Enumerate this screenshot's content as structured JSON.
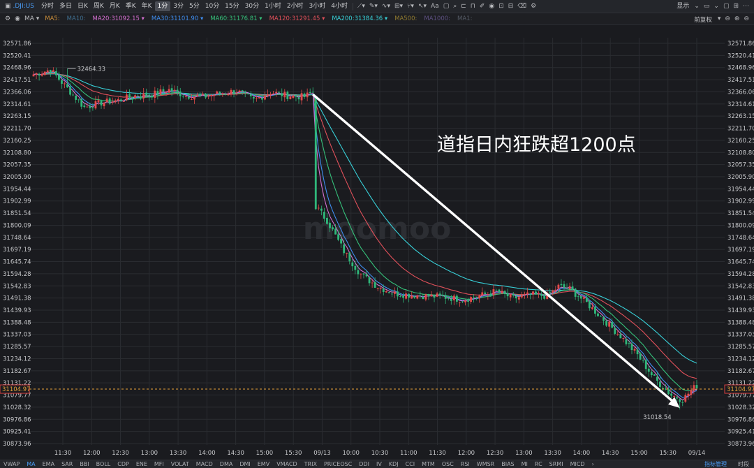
{
  "toolbar": {
    "symbol": ".DJI:US",
    "periods": [
      "分时",
      "多日",
      "日K",
      "周K",
      "月K",
      "季K",
      "年K",
      "1分",
      "3分",
      "5分",
      "10分",
      "15分",
      "30分",
      "1小时",
      "2小时",
      "3小时",
      "4小时"
    ],
    "active_period": "1分",
    "display_label": "显示"
  },
  "ma_bar": {
    "items": [
      {
        "label": "MA5:",
        "color": "#c58b3a"
      },
      {
        "label": "MA10:",
        "color": "#3f6e8f"
      },
      {
        "label": "MA20:31092.15",
        "color": "#d36fd0"
      },
      {
        "label": "MA30:31101.90",
        "color": "#3f8ef0"
      },
      {
        "label": "MA60:31176.81",
        "color": "#35c07a"
      },
      {
        "label": "MA120:31291.45",
        "color": "#e0505a"
      },
      {
        "label": "MA200:31384.36",
        "color": "#38d0d8"
      },
      {
        "label": "MA500:",
        "color": "#8f7a30"
      },
      {
        "label": "MA1000:",
        "color": "#5c4f80"
      },
      {
        "label": "MA1:",
        "color": "#555b66"
      }
    ],
    "adjust_label": "前复权"
  },
  "bottom_bar": {
    "indicators": [
      "VWAP",
      "MA",
      "EMA",
      "SAR",
      "BBI",
      "BOLL",
      "CDP",
      "ENE",
      "MFI",
      "VOLAT",
      "MACD",
      "DMA",
      "DMI",
      "EMV",
      "VMACD",
      "TRIX",
      "PRICEOSC",
      "DDI",
      "IV",
      "KDJ",
      "CCI",
      "MTM",
      "OSC",
      "RSI",
      "WMSR",
      "BIAS",
      "MI",
      "RC",
      "SRMI",
      "MICD"
    ],
    "active": "MA",
    "manage_label": "指标管理",
    "time_label": "时段"
  },
  "annotation": {
    "text": "道指日内狂跌超1200点"
  },
  "watermark": "moomoo",
  "colors": {
    "up": "#e24a4a",
    "down": "#2fb77a",
    "background": "#1a1b1f",
    "grid": "#2a2c31",
    "current_price": "#e8a23a"
  },
  "chart_data": {
    "type": "candlestick",
    "symbol": ".DJI:US",
    "y_ticks": [
      "32571.86",
      "32520.41",
      "32468.96",
      "32417.51",
      "32366.06",
      "32314.61",
      "32263.15",
      "32211.70",
      "32160.25",
      "32108.80",
      "32057.35",
      "32005.90",
      "31954.44",
      "31902.99",
      "31851.54",
      "31800.09",
      "31748.64",
      "31697.19",
      "31645.74",
      "31594.28",
      "31542.83",
      "31491.38",
      "31439.93",
      "31388.48",
      "31337.03",
      "31285.57",
      "31234.12",
      "31182.67",
      "31131.22",
      "31079.77",
      "31028.32",
      "30976.86",
      "30925.41",
      "30873.96"
    ],
    "ylim": [
      30873.96,
      32571.86
    ],
    "x_ticks": [
      "11:30",
      "12:00",
      "12:30",
      "13:00",
      "13:30",
      "14:00",
      "14:30",
      "15:00",
      "15:30",
      "09/13",
      "10:00",
      "10:30",
      "11:00",
      "11:30",
      "12:00",
      "12:30",
      "13:00",
      "13:30",
      "14:00",
      "14:30",
      "15:00",
      "15:30",
      "09/14"
    ],
    "current_price": 31104.97,
    "high_label": "32464.33",
    "low_label": "31018.54",
    "close_anchors": [
      [
        0,
        32440
      ],
      [
        6,
        32460
      ],
      [
        12,
        32380
      ],
      [
        18,
        32300
      ],
      [
        24,
        32320
      ],
      [
        30,
        32330
      ],
      [
        36,
        32350
      ],
      [
        42,
        32355
      ],
      [
        48,
        32375
      ],
      [
        54,
        32350
      ],
      [
        60,
        32345
      ],
      [
        66,
        32360
      ],
      [
        72,
        32370
      ],
      [
        78,
        32330
      ],
      [
        84,
        32365
      ],
      [
        90,
        32350
      ],
      [
        96,
        32345
      ],
      [
        99,
        32365
      ],
      [
        100,
        31880
      ],
      [
        104,
        31820
      ],
      [
        110,
        31690
      ],
      [
        116,
        31590
      ],
      [
        122,
        31540
      ],
      [
        128,
        31510
      ],
      [
        134,
        31505
      ],
      [
        140,
        31500
      ],
      [
        146,
        31495
      ],
      [
        152,
        31485
      ],
      [
        158,
        31500
      ],
      [
        164,
        31520
      ],
      [
        170,
        31490
      ],
      [
        176,
        31505
      ],
      [
        182,
        31500
      ],
      [
        186,
        31540
      ],
      [
        190,
        31530
      ],
      [
        196,
        31470
      ],
      [
        202,
        31400
      ],
      [
        208,
        31330
      ],
      [
        214,
        31250
      ],
      [
        220,
        31150
      ],
      [
        226,
        31080
      ],
      [
        230,
        31060
      ],
      [
        233,
        31100
      ],
      [
        235,
        31120
      ]
    ],
    "ma_final": {
      "MA20": 31092.15,
      "MA30": 31101.9,
      "MA60": 31176.81,
      "MA120": 31291.45,
      "MA200": 31384.36
    }
  }
}
